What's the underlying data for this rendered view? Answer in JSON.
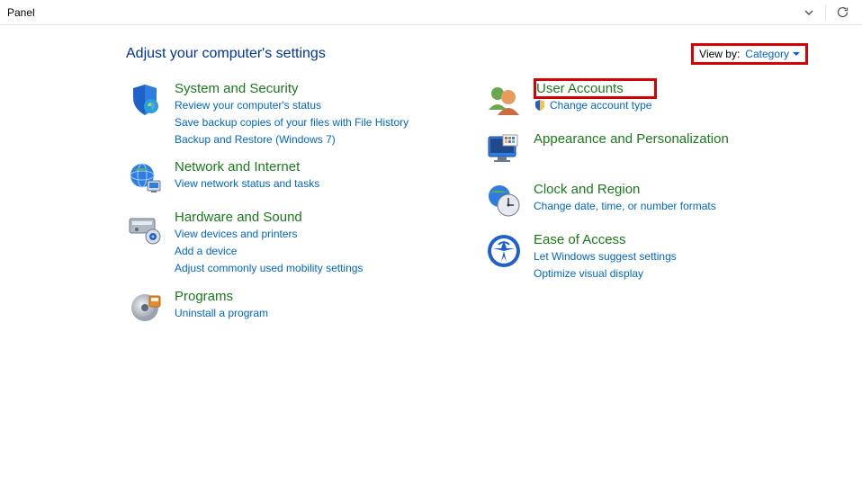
{
  "titlebar": {
    "title": "Panel"
  },
  "heading": "Adjust your computer's settings",
  "viewby": {
    "label": "View by:",
    "value": "Category"
  },
  "left": [
    {
      "id": "system-security",
      "title": "System and Security",
      "links": [
        "Review your computer's status",
        "Save backup copies of your files with File History",
        "Backup and Restore (Windows 7)"
      ]
    },
    {
      "id": "network-internet",
      "title": "Network and Internet",
      "links": [
        "View network status and tasks"
      ]
    },
    {
      "id": "hardware-sound",
      "title": "Hardware and Sound",
      "links": [
        "View devices and printers",
        "Add a device",
        "Adjust commonly used mobility settings"
      ]
    },
    {
      "id": "programs",
      "title": "Programs",
      "links": [
        "Uninstall a program"
      ]
    }
  ],
  "right": [
    {
      "id": "user-accounts",
      "title": "User Accounts",
      "links": [
        "Change account type"
      ],
      "shield_link": true,
      "highlight_title": true
    },
    {
      "id": "appearance-personalization",
      "title": "Appearance and Personalization",
      "links": []
    },
    {
      "id": "clock-region",
      "title": "Clock and Region",
      "links": [
        "Change date, time, or number formats"
      ]
    },
    {
      "id": "ease-of-access",
      "title": "Ease of Access",
      "links": [
        "Let Windows suggest settings",
        "Optimize visual display"
      ]
    }
  ]
}
